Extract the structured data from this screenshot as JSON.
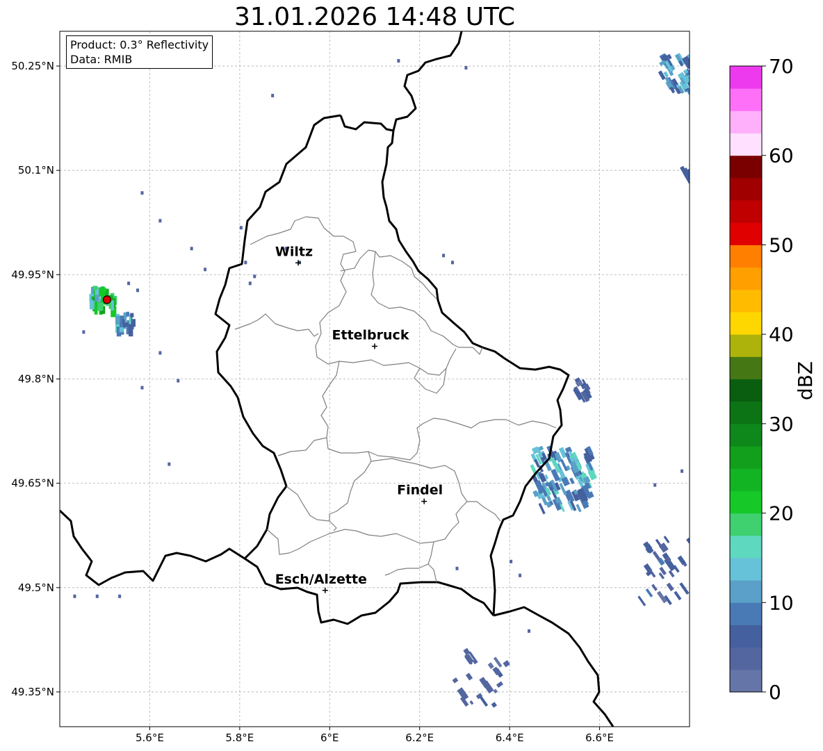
{
  "title": "31.01.2026 14:48 UTC",
  "info": {
    "product": "Product: 0.3° Reflectivity",
    "source": "Data: RMIB"
  },
  "map": {
    "lon_range": [
      5.4,
      6.8
    ],
    "lat_range": [
      49.3,
      50.3
    ],
    "lon_ticks": [
      {
        "value": 5.6,
        "label": "5.6°E"
      },
      {
        "value": 5.8,
        "label": "5.8°E"
      },
      {
        "value": 6.0,
        "label": "6°E"
      },
      {
        "value": 6.2,
        "label": "6.2°E"
      },
      {
        "value": 6.4,
        "label": "6.4°E"
      },
      {
        "value": 6.6,
        "label": "6.6°E"
      }
    ],
    "lat_ticks": [
      {
        "value": 50.25,
        "label": "50.25°N"
      },
      {
        "value": 50.1,
        "label": "50.1°N"
      },
      {
        "value": 49.95,
        "label": "49.95°N"
      },
      {
        "value": 49.8,
        "label": "49.8°N"
      },
      {
        "value": 49.65,
        "label": "49.65°N"
      },
      {
        "value": 49.5,
        "label": "49.5°N"
      },
      {
        "value": 49.35,
        "label": "49.35°N"
      }
    ],
    "cities": [
      {
        "name": "Wiltz",
        "lon": 5.93,
        "lat": 49.967
      },
      {
        "name": "Ettelbruck",
        "lon": 6.1,
        "lat": 49.847
      },
      {
        "name": "Findel",
        "lon": 6.21,
        "lat": 49.624
      },
      {
        "name": "Esch/Alzette",
        "lon": 5.99,
        "lat": 49.496
      }
    ],
    "radar_site": {
      "name": "radar",
      "lon": 5.505,
      "lat": 49.914
    }
  },
  "colorbar": {
    "label": "dBZ",
    "min": 0,
    "max": 70,
    "tick_values": [
      0,
      10,
      20,
      30,
      40,
      50,
      60,
      70
    ],
    "tick_labels": [
      "0",
      "10",
      "20",
      "30",
      "40",
      "50",
      "60",
      "70"
    ],
    "colors": [
      "#6675a8",
      "#5466a0",
      "#44609e",
      "#4a7ab5",
      "#5aa0c8",
      "#66c2d8",
      "#5fd8c0",
      "#3fd070",
      "#16c828",
      "#12b424",
      "#129f1c",
      "#0e881a",
      "#0c7414",
      "#0a5e10",
      "#457714",
      "#adb30a",
      "#ffd700",
      "#ffbb00",
      "#ff9f00",
      "#ff7f00",
      "#e00000",
      "#c00000",
      "#a00000",
      "#7a0000",
      "#ffe0fe",
      "#ffb0fb",
      "#ff70f8",
      "#ee3aee"
    ]
  },
  "echo_patches": [
    {
      "lon": 5.49,
      "lat": 49.918,
      "dbz": 20
    },
    {
      "lon": 5.54,
      "lat": 49.885,
      "dbz": 12
    },
    {
      "lon": 6.51,
      "lat": 49.66,
      "dbz": 14
    },
    {
      "lon": 6.77,
      "lat": 50.24,
      "dbz": 13
    },
    {
      "lon": 6.75,
      "lat": 49.53,
      "dbz": 7
    },
    {
      "lon": 6.33,
      "lat": 49.37,
      "dbz": 5
    }
  ]
}
